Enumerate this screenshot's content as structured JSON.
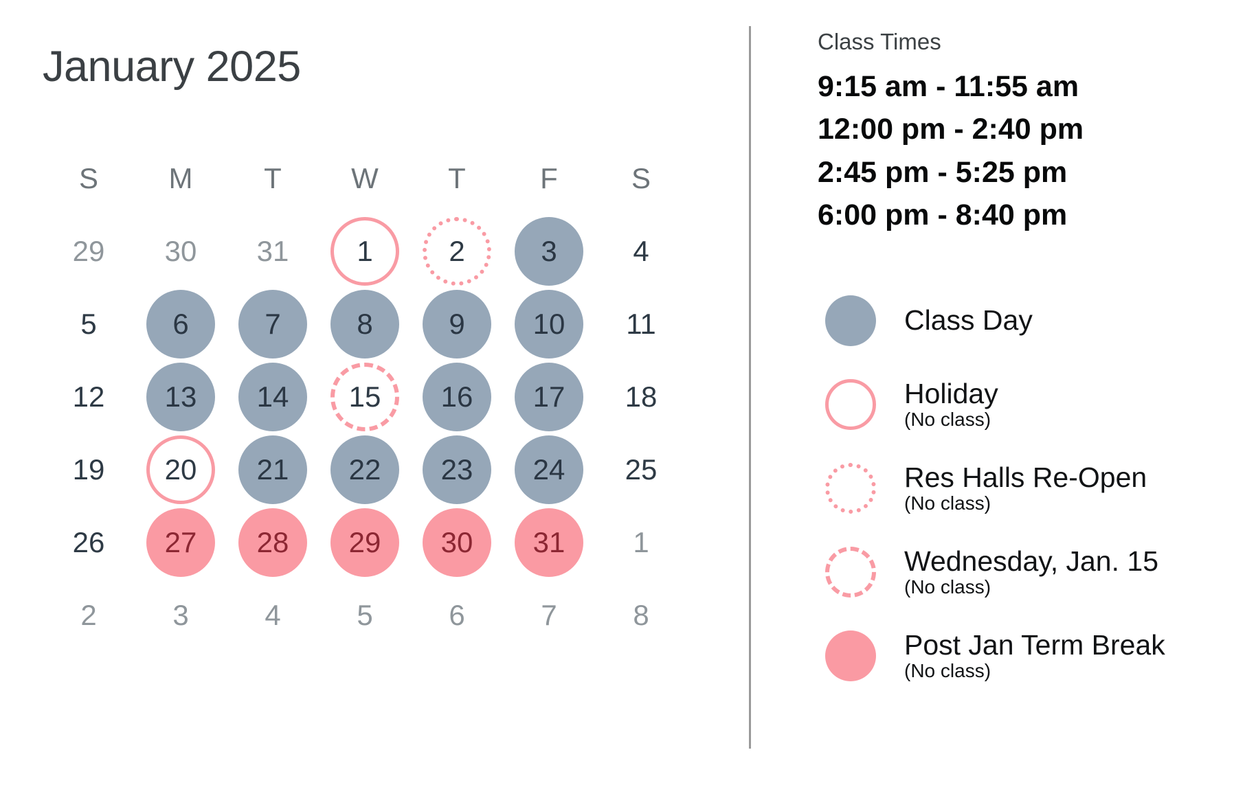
{
  "calendar": {
    "title": "January 2025",
    "weekday_headers": [
      "S",
      "M",
      "T",
      "W",
      "T",
      "F",
      "S"
    ],
    "weeks": [
      [
        {
          "label": "29",
          "type": "muted"
        },
        {
          "label": "30",
          "type": "muted"
        },
        {
          "label": "31",
          "type": "muted"
        },
        {
          "label": "1",
          "type": "holiday"
        },
        {
          "label": "2",
          "type": "dotted"
        },
        {
          "label": "3",
          "type": "class"
        },
        {
          "label": "4",
          "type": "plain"
        }
      ],
      [
        {
          "label": "5",
          "type": "plain"
        },
        {
          "label": "6",
          "type": "class"
        },
        {
          "label": "7",
          "type": "class"
        },
        {
          "label": "8",
          "type": "class"
        },
        {
          "label": "9",
          "type": "class"
        },
        {
          "label": "10",
          "type": "class"
        },
        {
          "label": "11",
          "type": "plain"
        }
      ],
      [
        {
          "label": "12",
          "type": "plain"
        },
        {
          "label": "13",
          "type": "class"
        },
        {
          "label": "14",
          "type": "class"
        },
        {
          "label": "15",
          "type": "dashed"
        },
        {
          "label": "16",
          "type": "class"
        },
        {
          "label": "17",
          "type": "class"
        },
        {
          "label": "18",
          "type": "plain"
        }
      ],
      [
        {
          "label": "19",
          "type": "plain"
        },
        {
          "label": "20",
          "type": "holiday"
        },
        {
          "label": "21",
          "type": "class"
        },
        {
          "label": "22",
          "type": "class"
        },
        {
          "label": "23",
          "type": "class"
        },
        {
          "label": "24",
          "type": "class"
        },
        {
          "label": "25",
          "type": "plain"
        }
      ],
      [
        {
          "label": "26",
          "type": "plain"
        },
        {
          "label": "27",
          "type": "break"
        },
        {
          "label": "28",
          "type": "break"
        },
        {
          "label": "29",
          "type": "break"
        },
        {
          "label": "30",
          "type": "break"
        },
        {
          "label": "31",
          "type": "break"
        },
        {
          "label": "1",
          "type": "muted"
        }
      ],
      [
        {
          "label": "2",
          "type": "muted"
        },
        {
          "label": "3",
          "type": "muted"
        },
        {
          "label": "4",
          "type": "muted"
        },
        {
          "label": "5",
          "type": "muted"
        },
        {
          "label": "6",
          "type": "muted"
        },
        {
          "label": "7",
          "type": "muted"
        },
        {
          "label": "8",
          "type": "muted"
        }
      ]
    ]
  },
  "class_times": {
    "heading": "Class Times",
    "rows": [
      "9:15 am - 11:55 am",
      "12:00 pm - 2:40 pm",
      "2:45 pm - 5:25 pm",
      "6:00 pm - 8:40 pm"
    ]
  },
  "legend": {
    "items": [
      {
        "label": "Class Day",
        "sub": "",
        "swatch": "class"
      },
      {
        "label": "Holiday",
        "sub": "(No class)",
        "swatch": "holiday"
      },
      {
        "label": "Res Halls Re-Open",
        "sub": "(No class)",
        "swatch": "dotted"
      },
      {
        "label": "Wednesday, Jan. 15",
        "sub": "(No class)",
        "swatch": "dashed"
      },
      {
        "label": "Post Jan Term Break",
        "sub": "(No class)",
        "swatch": "break"
      }
    ]
  },
  "colors": {
    "class_day": "#96a7b8",
    "break_day": "#fa9aa3",
    "accent_pink": "#f99ba4",
    "title_text": "#3b4044",
    "muted_text": "#8f969b",
    "divider": "#9a9a9a"
  }
}
